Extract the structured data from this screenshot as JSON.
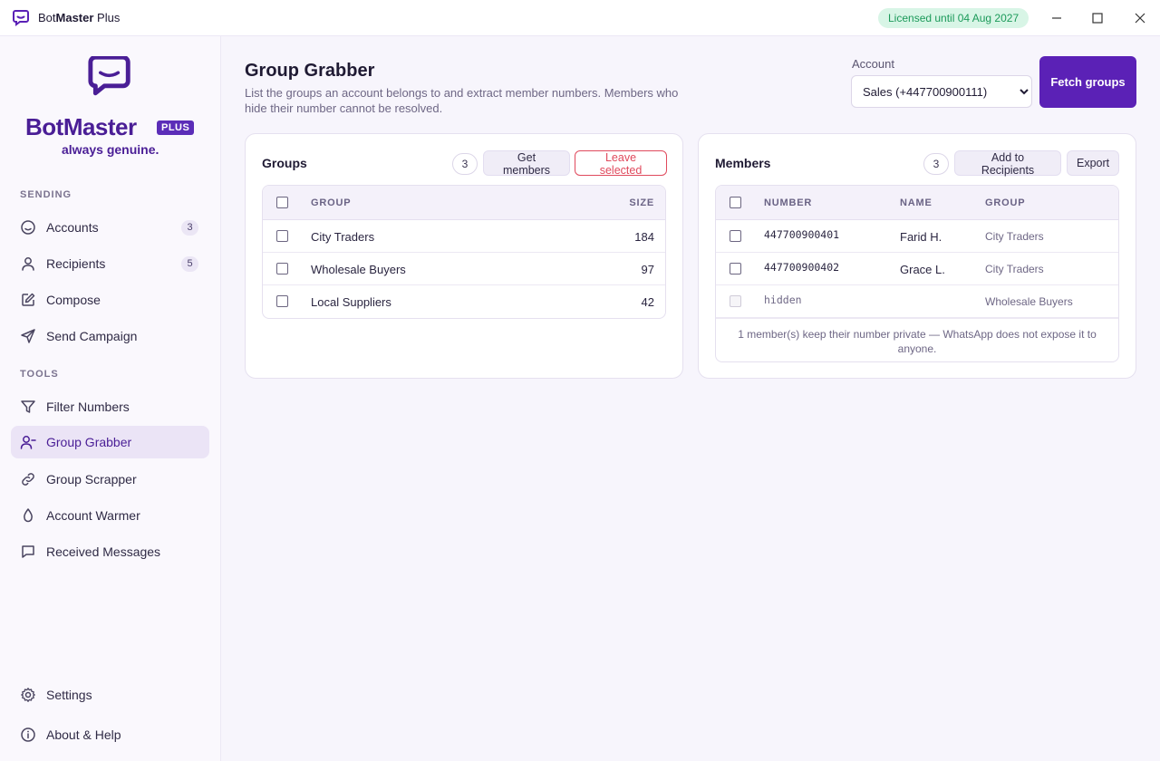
{
  "titlebar": {
    "app_name_prefix": "Bot",
    "app_name_bold": "Master",
    "app_name_suffix": " Plus",
    "license": "Licensed until 04 Aug 2027"
  },
  "logo": {
    "word": "BotMaster",
    "plus": "PLUS",
    "tagline": "always genuine."
  },
  "sidebar": {
    "sections": [
      {
        "label": "SENDING",
        "items": [
          {
            "label": "Accounts",
            "icon": "smiley-icon",
            "badge": "3"
          },
          {
            "label": "Recipients",
            "icon": "user-icon",
            "badge": "5"
          },
          {
            "label": "Compose",
            "icon": "pencil-icon",
            "badge": ""
          },
          {
            "label": "Send Campaign",
            "icon": "send-icon",
            "badge": ""
          }
        ]
      },
      {
        "label": "TOOLS",
        "items": [
          {
            "label": "Filter Numbers",
            "icon": "filter-icon",
            "badge": ""
          },
          {
            "label": "Group Grabber",
            "icon": "user-minus-icon",
            "badge": "",
            "active": true
          },
          {
            "label": "Group Scrapper",
            "icon": "link-icon",
            "badge": ""
          },
          {
            "label": "Account Warmer",
            "icon": "drop-icon",
            "badge": ""
          },
          {
            "label": "Received Messages",
            "icon": "message-icon",
            "badge": ""
          }
        ]
      }
    ],
    "footer": [
      {
        "label": "Settings",
        "icon": "gear-icon"
      },
      {
        "label": "About & Help",
        "icon": "info-icon"
      }
    ]
  },
  "page": {
    "title": "Group Grabber",
    "description": "List the groups an account belongs to and extract member numbers. Members who hide their number cannot be resolved.",
    "account_label": "Account",
    "account_selected": "Sales (+447700900111)",
    "fetch_label": "Fetch groups"
  },
  "groups": {
    "title": "Groups",
    "count": "3",
    "get_members_label": "Get members",
    "leave_label": "Leave selected",
    "columns": [
      "GROUP",
      "SIZE"
    ],
    "rows": [
      {
        "group": "City Traders",
        "size": "184"
      },
      {
        "group": "Wholesale Buyers",
        "size": "97"
      },
      {
        "group": "Local Suppliers",
        "size": "42"
      }
    ]
  },
  "members": {
    "title": "Members",
    "count": "3",
    "add_label": "Add to Recipients",
    "export_label": "Export",
    "columns": [
      "NUMBER",
      "NAME",
      "GROUP"
    ],
    "rows": [
      {
        "number": "447700900401",
        "name": "Farid H.",
        "group": "City Traders",
        "hidden": false
      },
      {
        "number": "447700900402",
        "name": "Grace L.",
        "group": "City Traders",
        "hidden": false
      },
      {
        "number": "hidden",
        "name": "",
        "group": "Wholesale Buyers",
        "hidden": true
      }
    ],
    "note": "1 member(s) keep their number private — WhatsApp does not expose it to anyone."
  },
  "colors": {
    "accent": "#5b21b6",
    "active_nav_bg": "#ebe4f6",
    "license_bg": "#d8f5e6",
    "license_text": "#1c9a5a",
    "danger": "#e04a5d"
  }
}
